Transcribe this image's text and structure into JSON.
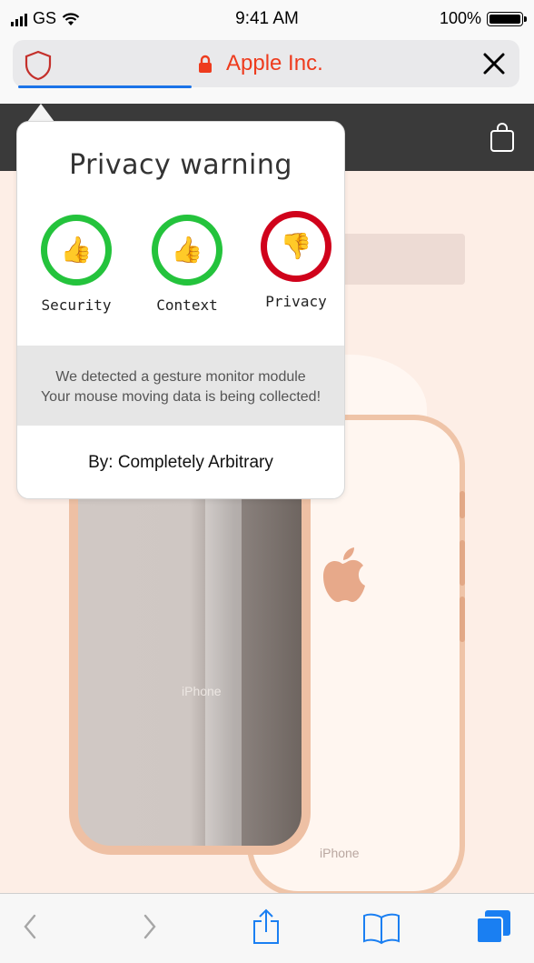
{
  "status_bar": {
    "carrier": "GS",
    "time": "9:41 AM",
    "battery": "100%"
  },
  "url_bar": {
    "site_title": "Apple Inc.",
    "load_progress": 0.35
  },
  "popover": {
    "title": "Privacy warning",
    "indicators": [
      {
        "label": "Security",
        "status": "good",
        "icon": "thumbs-up-icon"
      },
      {
        "label": "Context",
        "status": "good",
        "icon": "thumbs-up-icon"
      },
      {
        "label": "Privacy",
        "status": "bad",
        "icon": "thumbs-down-icon"
      }
    ],
    "message_line1": "We detected a gesture monitor module",
    "message_line2": "Your mouse moving data is being collected!",
    "by_line": "By: Completely Arbitrary"
  },
  "page": {
    "phone_label_front": "iPhone",
    "phone_label_back": "iPhone"
  },
  "toolbar": {
    "items": [
      "back-icon",
      "forward-icon",
      "share-icon",
      "bookmarks-icon",
      "tabs-icon"
    ]
  },
  "colors": {
    "site_title": "#ee3b1d",
    "good": "#24c33c",
    "bad": "#d0021b",
    "accent": "#1a73e8"
  }
}
